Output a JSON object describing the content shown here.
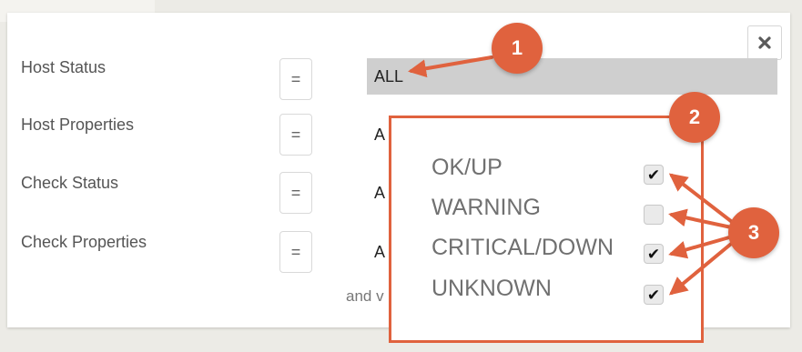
{
  "filter_rows": [
    {
      "label": "Host Status",
      "operator": "=",
      "value": "ALL"
    },
    {
      "label": "Host Properties",
      "operator": "=",
      "value": "A"
    },
    {
      "label": "Check Status",
      "operator": "=",
      "value": "A"
    },
    {
      "label": "Check Properties",
      "operator": "=",
      "value": "A"
    }
  ],
  "footer_text": "and v",
  "status_options": [
    {
      "label": "OK/UP",
      "checked": true
    },
    {
      "label": "WARNING",
      "checked": false
    },
    {
      "label": "CRITICAL/DOWN",
      "checked": true
    },
    {
      "label": "UNKNOWN",
      "checked": true
    }
  ],
  "close_icon": "close-icon",
  "checkmark_glyph": "✔",
  "callouts": [
    "1",
    "2",
    "3"
  ],
  "colors": {
    "accent": "#e0623e",
    "selected_field": "#cfcfcf"
  }
}
